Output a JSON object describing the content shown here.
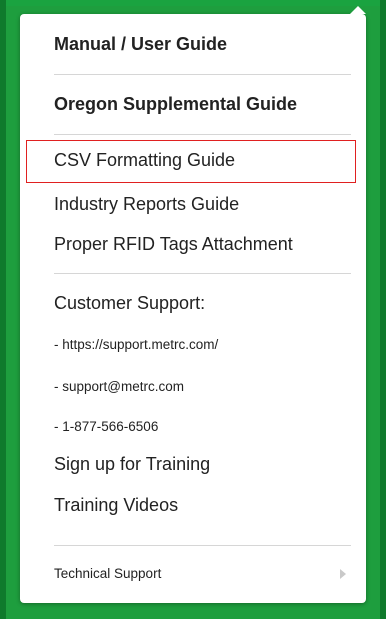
{
  "menu": {
    "manual_user_guide": "Manual / User Guide",
    "oregon_supplemental_guide": "Oregon Supplemental Guide",
    "csv_formatting_guide": "CSV Formatting Guide",
    "industry_reports_guide": "Industry Reports Guide",
    "proper_rfid_tags_attachment": "Proper RFID Tags Attachment",
    "customer_support": "Customer Support:",
    "support_url": "- https://support.metrc.com/",
    "support_email": "- support@metrc.com",
    "support_phone": "- 1-877-566-6506",
    "sign_up_for_training": "Sign up for Training",
    "training_videos": "Training Videos",
    "technical_support": "Technical Support"
  },
  "colors": {
    "background_green": "#1e9e3e",
    "highlight_border": "#e02020",
    "text": "#222222"
  },
  "icons": {
    "technical_support_chevron": "chevron-right-icon"
  }
}
